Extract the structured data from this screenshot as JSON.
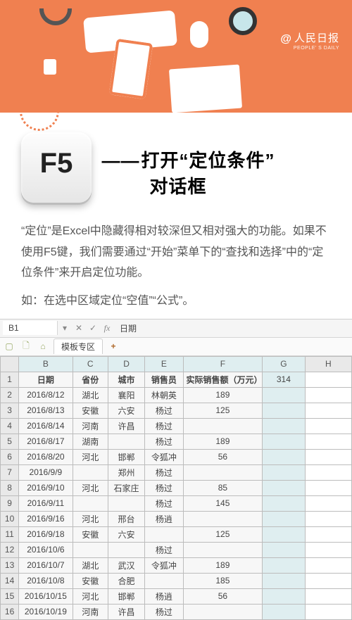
{
  "brand": {
    "at": "@",
    "cn": "人民日报",
    "en": "PEOPLE' S DAILY"
  },
  "hero": {
    "key": "F5",
    "dash": "——",
    "title_a": "打开“定位条件”",
    "title_b": "对话框"
  },
  "desc": "“定位”是Excel中隐藏得相对较深但又相对强大的功能。如果不使用F5键，我们需要通过“开始”菜单下的“查找和选择”中的“定位条件”来开启定位功能。",
  "example": "如：在选中区域定位“空值”“公式”。",
  "sheet": {
    "namebox": "B1",
    "fx_drop": "▾",
    "fx_x": "✕",
    "fx_v": "✓",
    "fx_label": "fx",
    "formula_value": "日期",
    "tab_icons": {
      "new": "▢",
      "open": "🗋",
      "home": "⌂"
    },
    "tab_label": "模板专区",
    "tab_plus": "+",
    "col_letters": [
      "",
      "B",
      "C",
      "D",
      "E",
      "F",
      "G",
      "H"
    ],
    "headers": [
      "日期",
      "省份",
      "城市",
      "销售员",
      "实际销售额（万元）"
    ],
    "g1": "314",
    "rows": [
      {
        "n": "2",
        "d": "2016/8/12",
        "p": "湖北",
        "c": "襄阳",
        "s": "林朝英",
        "v": "189"
      },
      {
        "n": "3",
        "d": "2016/8/13",
        "p": "安徽",
        "c": "六安",
        "s": "杨过",
        "v": "125"
      },
      {
        "n": "4",
        "d": "2016/8/14",
        "p": "河南",
        "c": "许昌",
        "s": "杨过",
        "v": ""
      },
      {
        "n": "5",
        "d": "2016/8/17",
        "p": "湖南",
        "c": "",
        "s": "杨过",
        "v": "189"
      },
      {
        "n": "6",
        "d": "2016/8/20",
        "p": "河北",
        "c": "邯郸",
        "s": "令狐冲",
        "v": "56"
      },
      {
        "n": "7",
        "d": "2016/9/9",
        "p": "",
        "c": "郑州",
        "s": "杨过",
        "v": ""
      },
      {
        "n": "8",
        "d": "2016/9/10",
        "p": "河北",
        "c": "石家庄",
        "s": "杨过",
        "v": "85"
      },
      {
        "n": "9",
        "d": "2016/9/11",
        "p": "",
        "c": "",
        "s": "杨过",
        "v": "145"
      },
      {
        "n": "10",
        "d": "2016/9/16",
        "p": "河北",
        "c": "邢台",
        "s": "杨逍",
        "v": ""
      },
      {
        "n": "11",
        "d": "2016/9/18",
        "p": "安徽",
        "c": "六安",
        "s": "",
        "v": "125"
      },
      {
        "n": "12",
        "d": "2016/10/6",
        "p": "",
        "c": "",
        "s": "杨过",
        "v": ""
      },
      {
        "n": "13",
        "d": "2016/10/7",
        "p": "湖北",
        "c": "武汉",
        "s": "令狐冲",
        "v": "189"
      },
      {
        "n": "14",
        "d": "2016/10/8",
        "p": "安徽",
        "c": "合肥",
        "s": "",
        "v": "185"
      },
      {
        "n": "15",
        "d": "2016/10/15",
        "p": "河北",
        "c": "邯郸",
        "s": "杨逍",
        "v": "56"
      },
      {
        "n": "16",
        "d": "2016/10/19",
        "p": "河南",
        "c": "许昌",
        "s": "杨过",
        "v": ""
      }
    ]
  }
}
